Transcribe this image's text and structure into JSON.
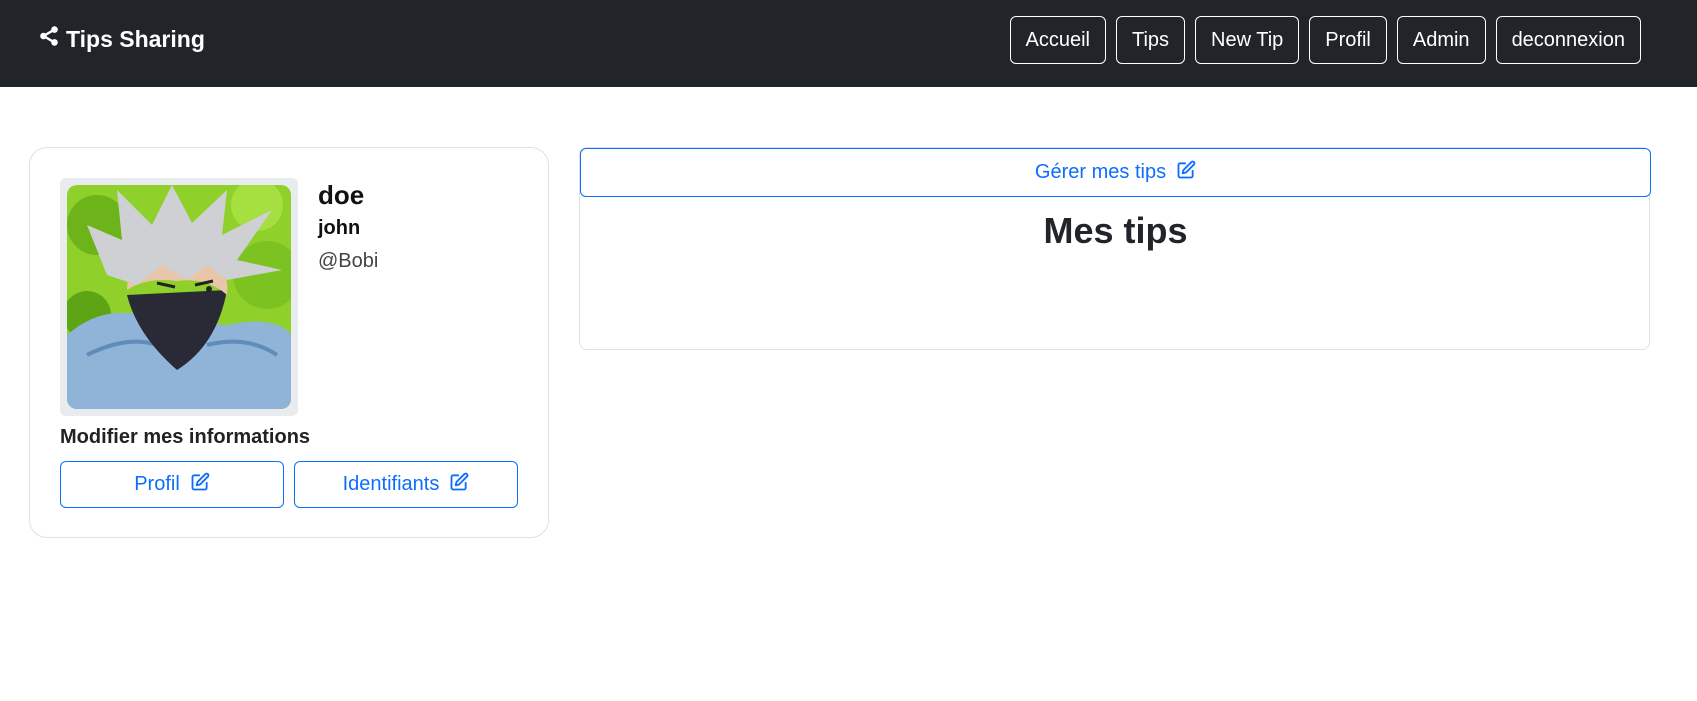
{
  "brand": {
    "name": "Tips Sharing",
    "icon": "share-icon"
  },
  "nav": {
    "links": [
      "Accueil",
      "Tips",
      "New Tip",
      "Profil",
      "Admin",
      "deconnexion"
    ]
  },
  "profile": {
    "lastname": "doe",
    "firstname": "john",
    "username": "@Bobi",
    "edit_heading": "Modifier mes informations",
    "edit_profile_label": "Profil",
    "edit_credentials_label": "Identifiants",
    "edit_icon": "edit-icon"
  },
  "tips": {
    "manage_label": "Gérer mes tips",
    "title": "Mes tips"
  },
  "colors": {
    "navbar": "#212529",
    "accent": "#0d6efd"
  }
}
